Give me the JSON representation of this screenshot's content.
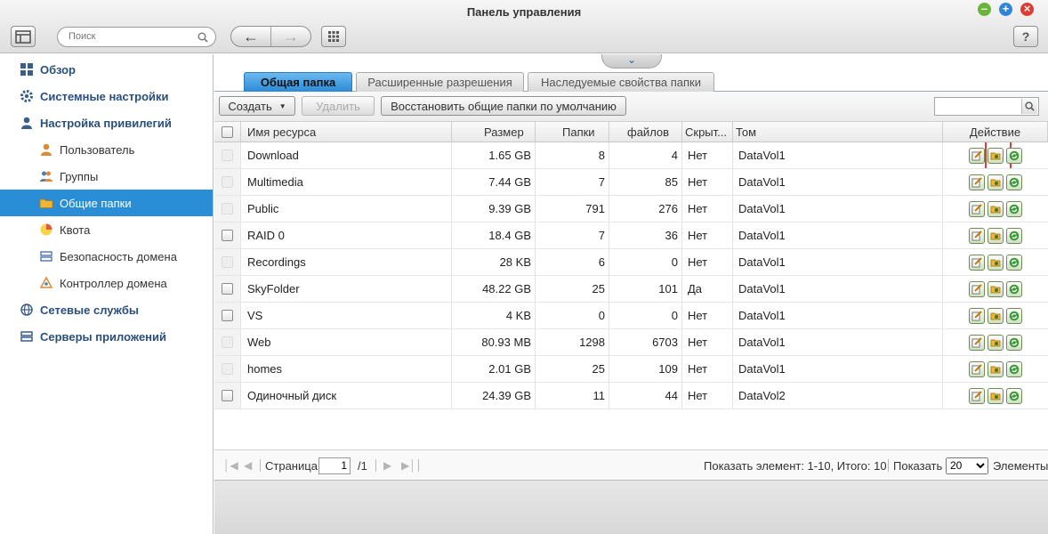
{
  "window": {
    "title": "Панель управления"
  },
  "topbar": {
    "search_placeholder": "Поиск",
    "help_label": "?"
  },
  "sidebar": {
    "items": [
      {
        "label": "Обзор",
        "level": "top",
        "icon": "overview-icon"
      },
      {
        "label": "Системные настройки",
        "level": "top",
        "icon": "gear-icon"
      },
      {
        "label": "Настройка привилегий",
        "level": "top",
        "icon": "user-icon"
      },
      {
        "label": "Пользователь",
        "level": "sub",
        "icon": "person-icon"
      },
      {
        "label": "Группы",
        "level": "sub",
        "icon": "group-icon"
      },
      {
        "label": "Общие папки",
        "level": "sub",
        "icon": "folder-icon",
        "active": true
      },
      {
        "label": "Квота",
        "level": "sub",
        "icon": "quota-icon"
      },
      {
        "label": "Безопасность домена",
        "level": "sub",
        "icon": "domain-security-icon"
      },
      {
        "label": "Контроллер домена",
        "level": "sub",
        "icon": "domain-controller-icon"
      },
      {
        "label": "Сетевые службы",
        "level": "top",
        "icon": "network-icon"
      },
      {
        "label": "Серверы приложений",
        "level": "top",
        "icon": "server-icon"
      }
    ]
  },
  "tabs": [
    {
      "label": "Общая папка",
      "active": true
    },
    {
      "label": "Расширенные разрешения"
    },
    {
      "label": "Наследуемые свойства папки"
    }
  ],
  "toolbar": {
    "create_label": "Создать",
    "delete_label": "Удалить",
    "restore_label": "Восстановить общие папки по умолчанию"
  },
  "table": {
    "columns": {
      "name": "Имя ресурса",
      "size": "Размер",
      "folders": "Папки",
      "files": "файлов",
      "hidden": "Скрыт...",
      "volume": "Том",
      "action": "Действие"
    },
    "rows": [
      {
        "name": "Download",
        "size": "1.65 GB",
        "folders": "8",
        "files": "4",
        "hidden": "Нет",
        "volume": "DataVol1",
        "checkbox": false
      },
      {
        "name": "Multimedia",
        "size": "7.44 GB",
        "folders": "7",
        "files": "85",
        "hidden": "Нет",
        "volume": "DataVol1",
        "checkbox": false
      },
      {
        "name": "Public",
        "size": "9.39 GB",
        "folders": "791",
        "files": "276",
        "hidden": "Нет",
        "volume": "DataVol1",
        "checkbox": false
      },
      {
        "name": "RAID 0",
        "size": "18.4 GB",
        "folders": "7",
        "files": "36",
        "hidden": "Нет",
        "volume": "DataVol1",
        "checkbox": true
      },
      {
        "name": "Recordings",
        "size": "28 KB",
        "folders": "6",
        "files": "0",
        "hidden": "Нет",
        "volume": "DataVol1",
        "checkbox": false
      },
      {
        "name": "SkyFolder",
        "size": "48.22 GB",
        "folders": "25",
        "files": "101",
        "hidden": "Да",
        "volume": "DataVol1",
        "checkbox": true
      },
      {
        "name": "VS",
        "size": "4 KB",
        "folders": "0",
        "files": "0",
        "hidden": "Нет",
        "volume": "DataVol1",
        "checkbox": true
      },
      {
        "name": "Web",
        "size": "80.93 MB",
        "folders": "1298",
        "files": "6703",
        "hidden": "Нет",
        "volume": "DataVol1",
        "checkbox": false
      },
      {
        "name": "homes",
        "size": "2.01 GB",
        "folders": "25",
        "files": "109",
        "hidden": "Нет",
        "volume": "DataVol1",
        "checkbox": false
      },
      {
        "name": "Одиночный диск",
        "size": "24.39 GB",
        "folders": "11",
        "files": "44",
        "hidden": "Нет",
        "volume": "DataVol2",
        "checkbox": true
      }
    ]
  },
  "pager": {
    "page_label": "Страница",
    "page_value": "1",
    "page_total": "/1",
    "summary": "Показать элемент: 1-10, Итого: 10",
    "show_label": "Показать",
    "per_page": "20",
    "items_label": "Элементы"
  },
  "colors": {
    "accent": "#2a8ed6",
    "highlight": "#e0393a"
  }
}
